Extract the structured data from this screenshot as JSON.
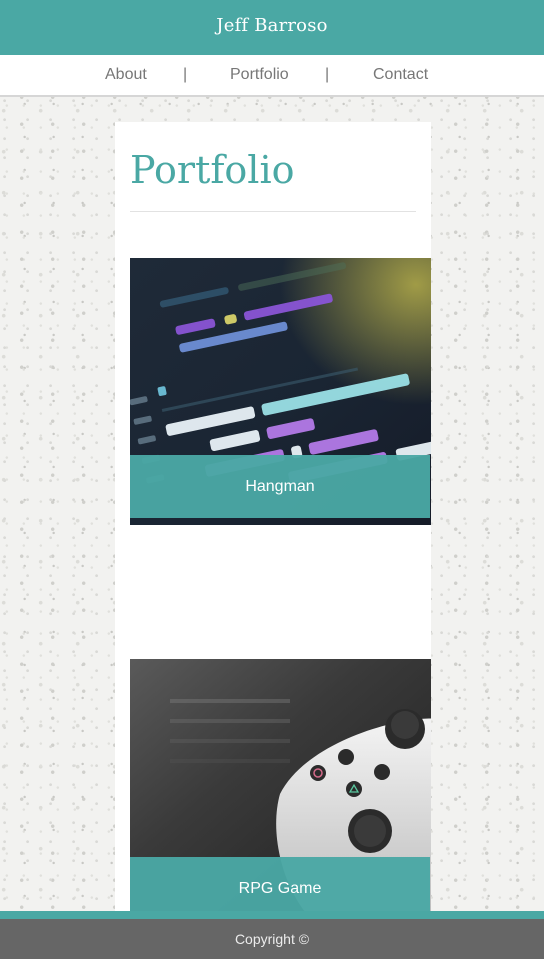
{
  "header": {
    "brand": "Jeff Barroso"
  },
  "nav": {
    "items": [
      {
        "label": "About"
      },
      {
        "label": "Portfolio"
      },
      {
        "label": "Contact"
      }
    ],
    "separator": "|"
  },
  "main": {
    "title": "Portfolio",
    "projects": [
      {
        "name": "Hangman",
        "image_icon": "code-editor-image"
      },
      {
        "name": "RPG Game",
        "image_icon": "game-controller-image"
      }
    ]
  },
  "footer": {
    "copyright": "Copyright ©"
  },
  "colors": {
    "accent": "#4aa8a4",
    "footer_bg": "#666666",
    "nav_text": "#777777"
  }
}
